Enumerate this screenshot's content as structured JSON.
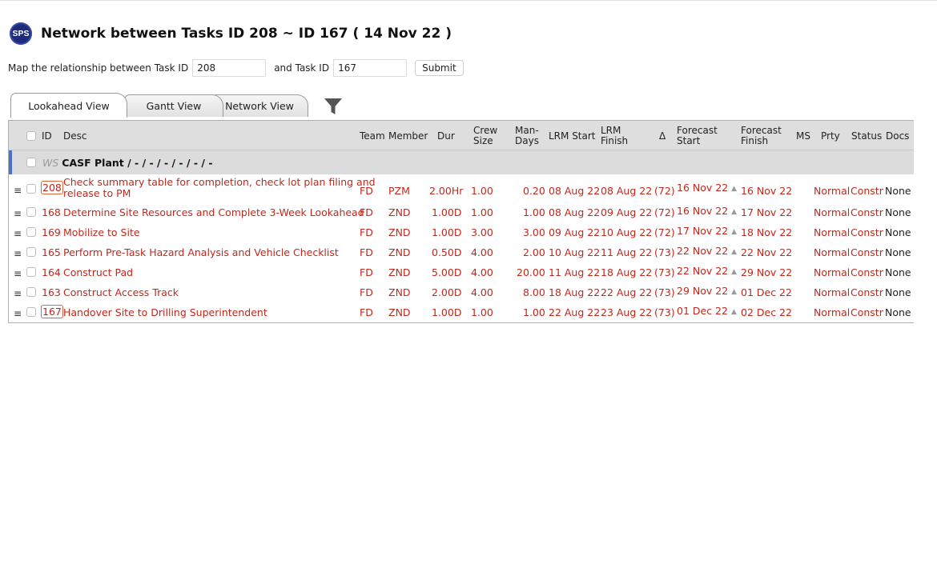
{
  "app": {
    "logo_text": "SPS",
    "title": "Network between Tasks ID 208 ~ ID 167 ( 14 Nov 22 )"
  },
  "map_form": {
    "label1": "Map the relationship between Task ID",
    "task_from": "208",
    "label2": "and Task ID",
    "task_to": "167",
    "submit_label": "Submit"
  },
  "tabs": [
    {
      "label": "Lookahead View",
      "active": true
    },
    {
      "label": "Gantt View",
      "active": false
    },
    {
      "label": "Network View",
      "active": false
    }
  ],
  "columns": {
    "id": "ID",
    "desc": "Desc",
    "team": "Team",
    "member": "Member",
    "dur": "Dur",
    "crew_1": "Crew",
    "crew_2": "Size",
    "man_1": "Man-",
    "man_2": "Days",
    "lrm_start": "LRM Start",
    "lrm_finish_1": "LRM",
    "lrm_finish_2": "Finish",
    "delta": "Δ",
    "fstart_1": "Forecast",
    "fstart_2": "Start",
    "ffinish_1": "Forecast",
    "ffinish_2": "Finish",
    "ms": "MS",
    "prty": "Prty",
    "status": "Status",
    "docs": "Docs"
  },
  "group": {
    "ws_label": "WS",
    "name": "CASF Plant / - / - / - / - / - / -"
  },
  "rows": [
    {
      "id": "208",
      "desc1": "Check summary table for completion, check lot plan filing and",
      "desc2": "release to PM",
      "team": "FD",
      "member": "PZM",
      "dur": "2.00Hr",
      "crew": "1.00",
      "man_days": "0.20",
      "lrm_start": "08 Aug 22",
      "lrm_finish": "08 Aug 22",
      "delta": "(72)",
      "f_start": "16 Nov 22",
      "f_finish": "16 Nov 22",
      "prty": "Normal",
      "status": "Constr",
      "docs": "None",
      "highlight": true
    },
    {
      "id": "168",
      "desc1": "Determine Site Resources and Complete 3-Week Lookahead",
      "desc2": "",
      "team": "FD",
      "member": "ZND",
      "dur": "1.00D",
      "crew": "1.00",
      "man_days": "1.00",
      "lrm_start": "08 Aug 22",
      "lrm_finish": "09 Aug 22",
      "delta": "(72)",
      "f_start": "16 Nov 22",
      "f_finish": "17 Nov 22",
      "prty": "Normal",
      "status": "Constr",
      "docs": "None",
      "highlight": false
    },
    {
      "id": "169",
      "desc1": "Mobilize to Site",
      "desc2": "",
      "team": "FD",
      "member": "ZND",
      "dur": "1.00D",
      "crew": "3.00",
      "man_days": "3.00",
      "lrm_start": "09 Aug 22",
      "lrm_finish": "10 Aug 22",
      "delta": "(72)",
      "f_start": "17 Nov 22",
      "f_finish": "18 Nov 22",
      "prty": "Normal",
      "status": "Constr",
      "docs": "None",
      "highlight": false
    },
    {
      "id": "165",
      "desc1": "Perform Pre-Task Hazard Analysis and Vehicle Checklist",
      "desc2": "",
      "team": "FD",
      "member": "ZND",
      "dur": "0.50D",
      "crew": "4.00",
      "man_days": "2.00",
      "lrm_start": "10 Aug 22",
      "lrm_finish": "11 Aug 22",
      "delta": "(73)",
      "f_start": "22 Nov 22",
      "f_finish": "22 Nov 22",
      "prty": "Normal",
      "status": "Constr",
      "docs": "None",
      "highlight": false
    },
    {
      "id": "164",
      "desc1": "Construct Pad",
      "desc2": "",
      "team": "FD",
      "member": "ZND",
      "dur": "5.00D",
      "crew": "4.00",
      "man_days": "20.00",
      "lrm_start": "11 Aug 22",
      "lrm_finish": "18 Aug 22",
      "delta": "(73)",
      "f_start": "22 Nov 22",
      "f_finish": "29 Nov 22",
      "prty": "Normal",
      "status": "Constr",
      "docs": "None",
      "highlight": false
    },
    {
      "id": "163",
      "desc1": "Construct Access Track",
      "desc2": "",
      "team": "FD",
      "member": "ZND",
      "dur": "2.00D",
      "crew": "4.00",
      "man_days": "8.00",
      "lrm_start": "18 Aug 22",
      "lrm_finish": "22 Aug 22",
      "delta": "(73)",
      "f_start": "29 Nov 22",
      "f_finish": "01 Dec 22",
      "prty": "Normal",
      "status": "Constr",
      "docs": "None",
      "highlight": false
    },
    {
      "id": "167",
      "desc1": "Handover Site to Drilling Superintendent",
      "desc2": "",
      "team": "FD",
      "member": "ZND",
      "dur": "1.00D",
      "crew": "1.00",
      "man_days": "1.00",
      "lrm_start": "22 Aug 22",
      "lrm_finish": "23 Aug 22",
      "delta": "(73)",
      "f_start": "01 Dec 22",
      "f_finish": "02 Dec 22",
      "prty": "Normal",
      "status": "Constr",
      "docs": "None",
      "highlight": true
    }
  ],
  "icons": {
    "row_menu": "hamburger-icon",
    "filter": "filter-funnel-icon",
    "forecast_marker": "triangle-up-icon"
  },
  "colors": {
    "task_text": "#c0281c",
    "highlight_border": "#e0633a",
    "group_bar": "#4a72c9",
    "header_bg": "#dedede",
    "logo_bg": "#1f2a7a"
  }
}
